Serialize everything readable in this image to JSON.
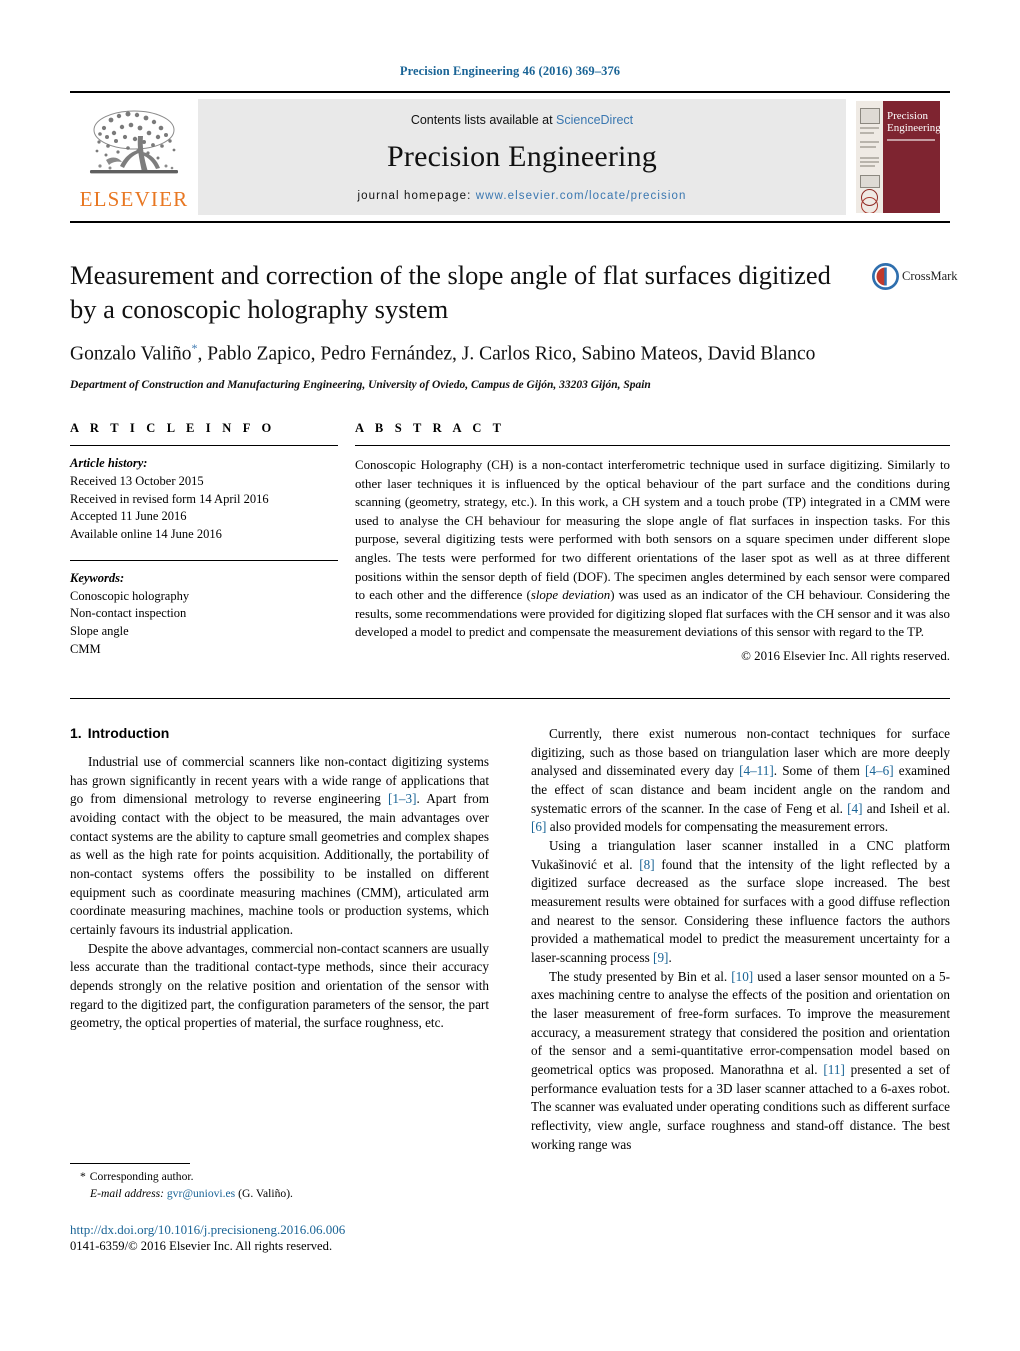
{
  "running_head": "Precision Engineering 46 (2016) 369–376",
  "masthead": {
    "publisher_name": "ELSEVIER",
    "contents_prefix": "Contents lists available at ",
    "contents_link": "ScienceDirect",
    "journal_title": "Precision Engineering",
    "homepage_prefix": "journal homepage:",
    "homepage_url": "www.elsevier.com/locate/precision",
    "cover": {
      "line1": "Precision",
      "line2": "Engineering"
    }
  },
  "article": {
    "title": "Measurement and correction of the slope angle of flat surfaces digitized by a conoscopic holography system",
    "crossmark_label": "CrossMark",
    "authors": "Gonzalo Valiño*, Pablo Zapico, Pedro Fernández, J. Carlos Rico, Sabino Mateos, David Blanco",
    "author_marker": "*",
    "affiliation": "Department of Construction and Manufacturing Engineering, University of Oviedo, Campus de Gijón, 33203 Gijón, Spain"
  },
  "info": {
    "heading": "A R T I C L E    I N F O",
    "history_label": "Article history:",
    "history": [
      "Received 13 October 2015",
      "Received in revised form 14 April 2016",
      "Accepted 11 June 2016",
      "Available online 14 June 2016"
    ],
    "keywords_label": "Keywords:",
    "keywords": [
      "Conoscopic holography",
      "Non-contact inspection",
      "Slope angle",
      "CMM"
    ]
  },
  "abstract": {
    "heading": "A B S T R A C T",
    "part1": "Conoscopic Holography (CH) is a non-contact interferometric technique used in surface digitizing. Similarly to other laser techniques it is influenced by the optical behaviour of the part surface and the conditions during scanning (geometry, strategy, etc.). In this work, a CH system and a touch probe (TP) integrated in a CMM were used to analyse the CH behaviour for measuring the slope angle of flat surfaces in inspection tasks. For this purpose, several digitizing tests were performed with both sensors on a square specimen under different slope angles. The tests were performed for two different orientations of the laser spot as well as at three different positions within the sensor depth of field (DOF). The specimen angles determined by each sensor were compared to each other and the difference (",
    "emphasis": "slope deviation",
    "part2": ") was used as an indicator of the CH behaviour. Considering the results, some recommendations were provided for digitizing sloped flat surfaces with the CH sensor and it was also developed a model to predict and compensate the measurement deviations of this sensor with regard to the TP.",
    "copyright": "© 2016 Elsevier Inc. All rights reserved."
  },
  "body": {
    "section_number": "1.",
    "section_title": "Introduction",
    "left_paragraphs": [
      {
        "segments": [
          {
            "t": "Industrial use of commercial scanners like non-contact digitizing systems has grown significantly in recent years with a wide range of applications that go from dimensional metrology to reverse engineering "
          },
          {
            "t": "[1–3]",
            "cite": true
          },
          {
            "t": ". Apart from avoiding contact with the object to be measured, the main advantages over contact systems are the ability to capture small geometries and complex shapes as well as the high rate for points acquisition. Additionally, the portability of non-contact systems offers the possibility to be installed on different equipment such as coordinate measuring machines (CMM), articulated arm coordinate measuring machines, machine tools or production systems, which certainly favours its industrial application."
          }
        ]
      },
      {
        "segments": [
          {
            "t": "Despite the above advantages, commercial non-contact scanners are usually less accurate than the traditional contact-type methods, since their accuracy depends strongly on the relative position and orientation of the sensor with regard to the digitized part, the configuration parameters of the sensor, the part geometry, the optical properties of material, the surface roughness, etc."
          }
        ]
      }
    ],
    "right_paragraphs": [
      {
        "segments": [
          {
            "t": "Currently, there exist numerous non-contact techniques for surface digitizing, such as those based on triangulation laser which are more deeply analysed and disseminated every day "
          },
          {
            "t": "[4–11]",
            "cite": true
          },
          {
            "t": ". Some of them "
          },
          {
            "t": "[4–6]",
            "cite": true
          },
          {
            "t": " examined the effect of scan distance and beam incident angle on the random and systematic errors of the scanner. In the case of Feng et al. "
          },
          {
            "t": "[4]",
            "cite": true
          },
          {
            "t": " and Isheil et al. "
          },
          {
            "t": "[6]",
            "cite": true
          },
          {
            "t": " also provided models for compensating the measurement errors."
          }
        ]
      },
      {
        "segments": [
          {
            "t": "Using a triangulation laser scanner installed in a CNC platform Vukašinović et al. "
          },
          {
            "t": "[8]",
            "cite": true
          },
          {
            "t": " found that the intensity of the light reflected by a digitized surface decreased as the surface slope increased. The best measurement results were obtained for surfaces with a good diffuse reflection and nearest to the sensor. Considering these influence factors the authors provided a mathematical model to predict the measurement uncertainty for a laser-scanning process "
          },
          {
            "t": "[9]",
            "cite": true
          },
          {
            "t": "."
          }
        ]
      },
      {
        "segments": [
          {
            "t": "The study presented by Bin et al. "
          },
          {
            "t": "[10]",
            "cite": true
          },
          {
            "t": " used a laser sensor mounted on a 5-axes machining centre to analyse the effects of the position and orientation on the laser measurement of free-form surfaces. To improve the measurement accuracy, a measurement strategy that considered the position and orientation of the sensor and a semi-quantitative error-compensation model based on geometrical optics was proposed. Manorathna et al. "
          },
          {
            "t": "[11]",
            "cite": true
          },
          {
            "t": " presented a set of performance evaluation tests for a 3D laser scanner attached to a 6-axes robot. The scanner was evaluated under operating conditions such as different surface reflectivity, view angle, surface roughness and stand-off distance. The best working range was"
          }
        ]
      }
    ]
  },
  "footnotes": {
    "corresponding_marker": "*",
    "corresponding_text": "Corresponding author.",
    "email_label": "E-mail address:",
    "email": "gvr@uniovi.es",
    "email_owner": "(G. Valiño).",
    "doi": "http://dx.doi.org/10.1016/j.precisioneng.2016.06.006",
    "issn_line": "0141-6359/© 2016 Elsevier Inc. All rights reserved."
  },
  "colors": {
    "link_blue": "#1a6496",
    "sd_blue": "#3a77b0",
    "elsevier_orange": "#e87722",
    "cover_red": "#7e2430"
  }
}
